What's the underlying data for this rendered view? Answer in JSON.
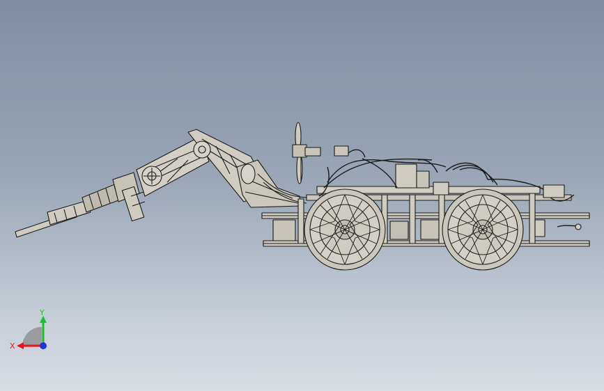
{
  "viewport": {
    "background_top": "#7f8da0",
    "background_bottom": "#d9dee5"
  },
  "model": {
    "line_color": "#1a1a1a",
    "fill_color": "#cfcbc1",
    "shade_color": "#b5b1a6"
  },
  "triad": {
    "x_label": "X",
    "y_label": "Y",
    "x_color": "#e8121a",
    "y_color": "#1fbf2b",
    "z_color": "#1a36d6",
    "icon": "coordinate-triad-icon"
  }
}
